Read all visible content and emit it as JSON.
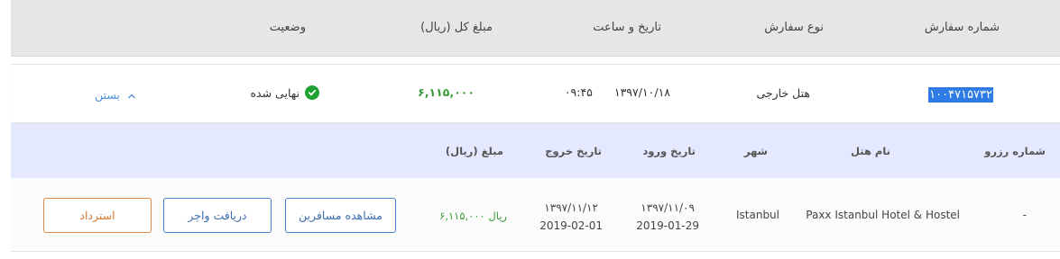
{
  "header": {
    "order_number": "شماره سفارش",
    "order_type": "نوع سفارش",
    "date_time": "تاریخ و ساعت",
    "total_amount": "مبلغ کل (ریال)",
    "status": "وضعیت"
  },
  "order": {
    "id": "۱۰۰۴۷۱۵۷۳۲",
    "type": "هتل خارجی",
    "date": "۱۳۹۷/۱۰/۱۸",
    "time": "۰۹:۴۵",
    "amount": "۶,۱۱۵,۰۰۰",
    "status": "نهایی شده",
    "close_label": "بستن"
  },
  "detail_header": {
    "reservation_number": "شماره رزرو",
    "hotel_name": "نام هتل",
    "city": "شهر",
    "checkin": "تاریخ ورود",
    "checkout": "تاریخ خروج",
    "amount": "مبلغ (ریال)"
  },
  "detail": {
    "reservation_number": "-",
    "hotel_name": "Paxx Istanbul Hotel & Hostel",
    "city": "Istanbul",
    "checkin_jalali": "۱۳۹۷/۱۱/۰۹",
    "checkin_gregorian": "2019-01-29",
    "checkout_jalali": "۱۳۹۷/۱۱/۱۲",
    "checkout_gregorian": "2019-02-01",
    "amount": "۶,۱۱۵,۰۰۰ ریال"
  },
  "buttons": {
    "view_passengers": "مشاهده مسافرین",
    "get_voucher": "دریافت واچر",
    "refund": "استرداد"
  },
  "colors": {
    "header_bg": "#e6e6e6",
    "detail_header_bg": "#e5e9ff",
    "amount_green": "#3a9b3a",
    "status_check": "#1ea331",
    "link_blue": "#4d8fd9",
    "button_blue": "#4a82c9",
    "button_orange": "#e08a45",
    "selection_blue": "#2f7be5"
  },
  "icons": {
    "status": "check-circle-icon",
    "collapse": "chevron-up-icon"
  }
}
